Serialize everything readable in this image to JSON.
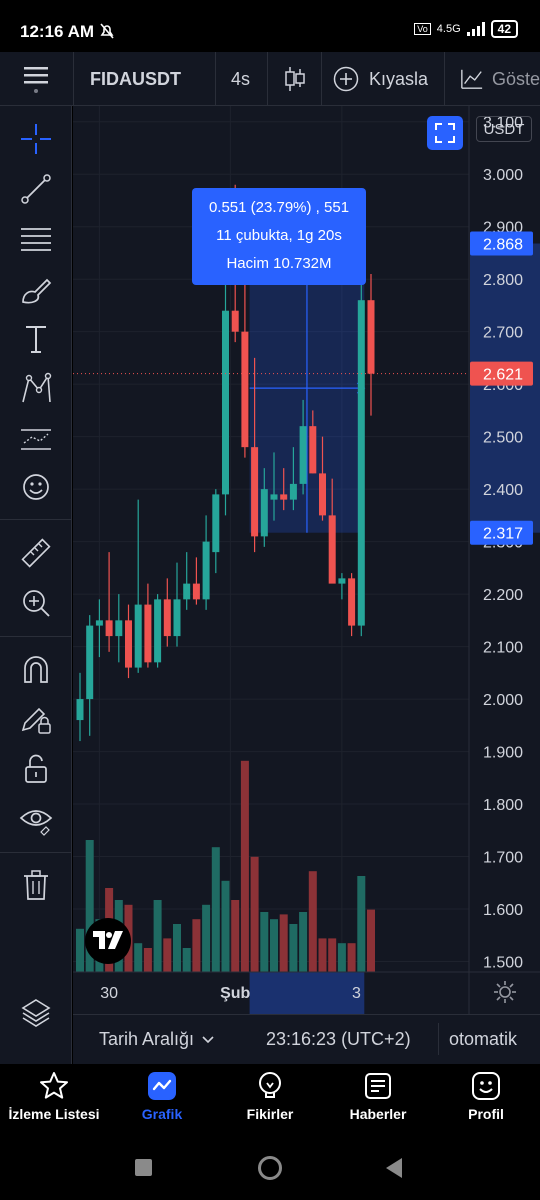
{
  "status": {
    "time": "12:16 AM",
    "net": "4.5G",
    "battery": "42"
  },
  "toolbar": {
    "symbol": "FIDAUSDT",
    "interval": "4s",
    "compare_label": "Kıyasla",
    "indicators_label": "Göste"
  },
  "axis": {
    "currency": "USDT",
    "ticks": [
      "3.100",
      "3.000",
      "2.900",
      "2.800",
      "2.700",
      "2.600",
      "2.500",
      "2.400",
      "2.300",
      "2.200",
      "2.100",
      "2.000",
      "1.900",
      "1.800",
      "1.700",
      "1.600",
      "1.500"
    ],
    "range": [
      1.48,
      3.13
    ],
    "high_label": "2.868",
    "last_label": "2.621",
    "low_label": "2.317",
    "x_labels": [
      "30",
      "Şub",
      "3"
    ]
  },
  "tooltip": {
    "line1": "0.551 (23.79%) , 551",
    "line2": "11 çubukta, 1g 20s",
    "line3": "Hacim 10.732M"
  },
  "bottom": {
    "range_label": "Tarih Aralığı",
    "clock": "23:16:23 (UTC+2)",
    "mode": "otomatik"
  },
  "nav": [
    {
      "label": "İzleme Listesi",
      "icon": "star-icon",
      "color": "#ffffff"
    },
    {
      "label": "Grafik",
      "icon": "chart-icon",
      "color": "#2962ff"
    },
    {
      "label": "Fikirler",
      "icon": "lightbulb-icon",
      "color": "#ffffff"
    },
    {
      "label": "Haberler",
      "icon": "newspaper-icon",
      "color": "#ffffff"
    },
    {
      "label": "Profil",
      "icon": "smiley-icon",
      "color": "#ffffff"
    }
  ],
  "colors": {
    "up": "#26a69a",
    "down": "#ef5350",
    "accent": "#2962ff",
    "bg": "#131722"
  },
  "chart_data": {
    "type": "candlestick",
    "ylim": [
      1.48,
      3.13
    ],
    "candles": [
      {
        "o": 1.96,
        "h": 2.05,
        "l": 1.92,
        "c": 2.0
      },
      {
        "o": 2.0,
        "h": 2.16,
        "l": 1.93,
        "c": 2.14
      },
      {
        "o": 2.14,
        "h": 2.19,
        "l": 2.08,
        "c": 2.15
      },
      {
        "o": 2.15,
        "h": 2.28,
        "l": 2.09,
        "c": 2.12
      },
      {
        "o": 2.12,
        "h": 2.2,
        "l": 2.07,
        "c": 2.15
      },
      {
        "o": 2.15,
        "h": 2.18,
        "l": 2.04,
        "c": 2.06
      },
      {
        "o": 2.06,
        "h": 2.38,
        "l": 2.05,
        "c": 2.18
      },
      {
        "o": 2.18,
        "h": 2.22,
        "l": 2.06,
        "c": 2.07
      },
      {
        "o": 2.07,
        "h": 2.2,
        "l": 2.06,
        "c": 2.19
      },
      {
        "o": 2.19,
        "h": 2.23,
        "l": 2.1,
        "c": 2.12
      },
      {
        "o": 2.12,
        "h": 2.26,
        "l": 2.1,
        "c": 2.19
      },
      {
        "o": 2.19,
        "h": 2.28,
        "l": 2.17,
        "c": 2.22
      },
      {
        "o": 2.22,
        "h": 2.27,
        "l": 2.18,
        "c": 2.19
      },
      {
        "o": 2.19,
        "h": 2.35,
        "l": 2.17,
        "c": 2.3
      },
      {
        "o": 2.28,
        "h": 2.4,
        "l": 2.24,
        "c": 2.39
      },
      {
        "o": 2.39,
        "h": 2.95,
        "l": 2.35,
        "c": 2.74
      },
      {
        "o": 2.74,
        "h": 2.98,
        "l": 2.68,
        "c": 2.7
      },
      {
        "o": 2.7,
        "h": 2.83,
        "l": 2.46,
        "c": 2.48
      },
      {
        "o": 2.48,
        "h": 2.65,
        "l": 2.28,
        "c": 2.31
      },
      {
        "o": 2.31,
        "h": 2.44,
        "l": 2.29,
        "c": 2.4
      },
      {
        "o": 2.38,
        "h": 2.47,
        "l": 2.34,
        "c": 2.39
      },
      {
        "o": 2.39,
        "h": 2.44,
        "l": 2.36,
        "c": 2.38
      },
      {
        "o": 2.38,
        "h": 2.48,
        "l": 2.36,
        "c": 2.41
      },
      {
        "o": 2.41,
        "h": 2.57,
        "l": 2.39,
        "c": 2.52
      },
      {
        "o": 2.52,
        "h": 2.55,
        "l": 2.43,
        "c": 2.43
      },
      {
        "o": 2.43,
        "h": 2.5,
        "l": 2.34,
        "c": 2.35
      },
      {
        "o": 2.35,
        "h": 2.42,
        "l": 2.29,
        "c": 2.22
      },
      {
        "o": 2.22,
        "h": 2.24,
        "l": 2.19,
        "c": 2.23
      },
      {
        "o": 2.23,
        "h": 2.24,
        "l": 2.12,
        "c": 2.14
      },
      {
        "o": 2.14,
        "h": 2.87,
        "l": 2.12,
        "c": 2.76
      },
      {
        "o": 2.76,
        "h": 2.81,
        "l": 2.54,
        "c": 2.62
      }
    ],
    "volume": [
      0.18,
      0.55,
      0.22,
      0.35,
      0.3,
      0.28,
      0.12,
      0.1,
      0.3,
      0.14,
      0.2,
      0.1,
      0.22,
      0.28,
      0.52,
      0.38,
      0.3,
      0.88,
      0.48,
      0.25,
      0.22,
      0.24,
      0.2,
      0.25,
      0.42,
      0.14,
      0.14,
      0.12,
      0.12,
      0.4,
      0.26
    ],
    "measure": {
      "from": 2.317,
      "to": 2.868,
      "start_bar": 18,
      "end_bar": 29
    }
  }
}
